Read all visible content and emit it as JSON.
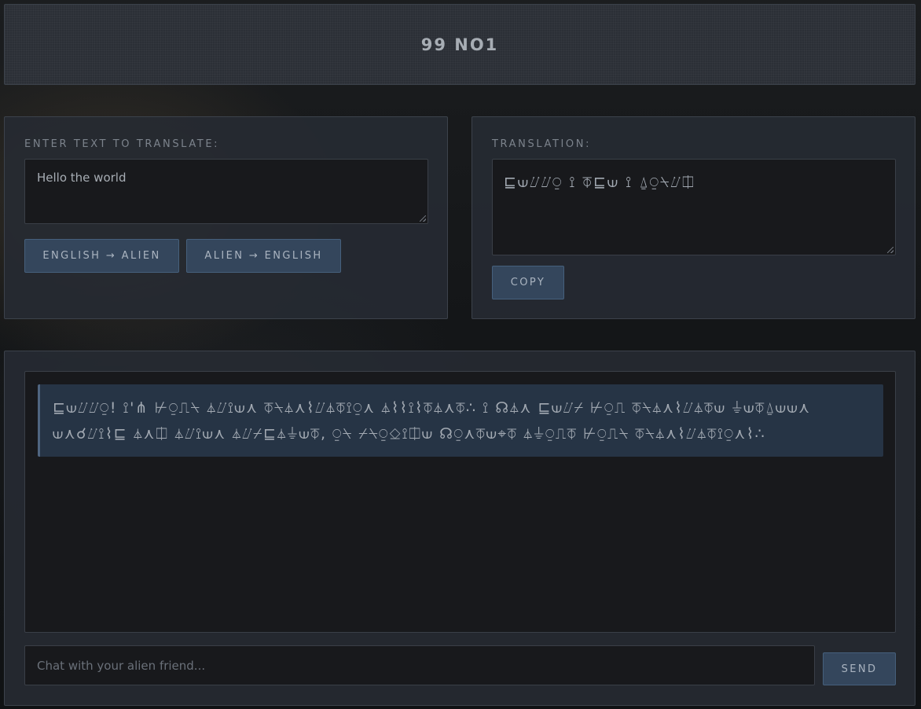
{
  "header": {
    "title": "99 NO1"
  },
  "input_panel": {
    "label": "ENTER TEXT TO TRANSLATE:",
    "text_value": "Hello the world",
    "buttons": {
      "english_to_alien": "ENGLISH → ALIEN",
      "alien_to_english": "ALIEN → ENGLISH"
    }
  },
  "output_panel": {
    "label": "TRANSLATION:",
    "translation": "⊑⟒⌰⌰⍜ ⟟ ⏁⊑⟒ ⟟ ⍙⍜⍀⌰⎅",
    "copy_label": "COPY"
  },
  "chat": {
    "messages": [
      {
        "sender": "alien",
        "text": "⊑⟒⌰⌰⍜! ⟟'⋔ ⊬⍜⎍⍀ ⏃⌰⟟⟒⋏ ⏁⍀⏃⋏⌇⌰⏃⏁⟟⍜⋏ ⏃⌇⌇⟟⌇⏁⏃⋏⏁∴ ⟟ ☊⏃⋏ ⊑⟒⌰⌿ ⊬⍜⎍ ⏁⍀⏃⋏⌇⌰⏃⏁⟒ ⏚⟒⏁⍙⟒⟒⋏ ⟒⋏☌⌰⟟⌇⊑ ⏃⋏⎅ ⏃⌰⟟⟒⋏ ⏃⌰⌿⊑⏃⏚⟒⏁, ⍜⍀ ⌿⍀⍜⎐⟟⎅⟒ ☊⍜⋏⏁⟒⌖⏁ ⏃⏚⍜⎍⏁ ⊬⍜⎍⍀ ⏁⍀⏃⋏⌇⌰⏃⏁⟟⍜⋏⌇∴"
      }
    ],
    "input_placeholder": "Chat with your alien friend...",
    "send_label": "SEND"
  }
}
